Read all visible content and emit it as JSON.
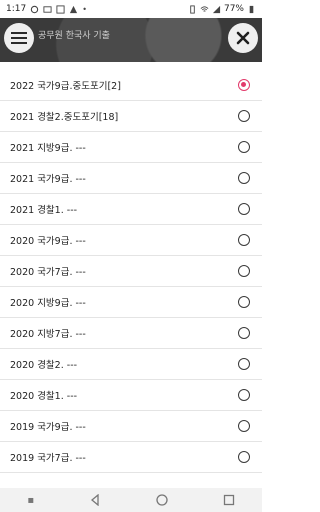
{
  "status_bar": {
    "time": "1:17",
    "battery": "77%"
  },
  "header": {
    "title": "공무원 한국사 기출",
    "menu_icon": "hamburger-menu-icon",
    "close_icon": "close-icon"
  },
  "list": {
    "items": [
      {
        "label": "2022 국가9급.중도포기[2]",
        "selected": true
      },
      {
        "label": "2021 경찰2.중도포기[18]",
        "selected": false
      },
      {
        "label": "2021 지방9급. ---",
        "selected": false
      },
      {
        "label": "2021 국가9급. ---",
        "selected": false
      },
      {
        "label": "2021 경찰1. ---",
        "selected": false
      },
      {
        "label": "2020 국가9급. ---",
        "selected": false
      },
      {
        "label": "2020 국가7급. ---",
        "selected": false
      },
      {
        "label": "2020 지방9급. ---",
        "selected": false
      },
      {
        "label": "2020 지방7급. ---",
        "selected": false
      },
      {
        "label": "2020 경찰2. ---",
        "selected": false
      },
      {
        "label": "2020 경찰1. ---",
        "selected": false
      },
      {
        "label": "2019 국가9급. ---",
        "selected": false
      },
      {
        "label": "2019 국가7급. ---",
        "selected": false
      }
    ]
  },
  "colors": {
    "accent": "#e23a6b"
  }
}
